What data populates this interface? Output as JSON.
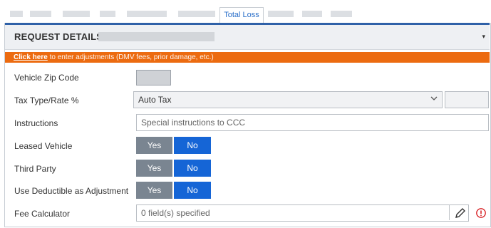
{
  "tabs": {
    "active_label": "Total Loss"
  },
  "header": {
    "title": "REQUEST DETAILS",
    "caret": "▾"
  },
  "banner": {
    "link": "Click here",
    "text": " to enter adjustments (DMV fees, prior damage, etc.)"
  },
  "fields": {
    "zip_label": "Vehicle Zip Code",
    "tax_label": "Tax Type/Rate %",
    "tax_value": "Auto Tax",
    "instructions_label": "Instructions",
    "instructions_placeholder": "Special instructions to CCC",
    "leased_label": "Leased Vehicle",
    "third_party_label": "Third Party",
    "deductible_label": "Use Deductible as Adjustment",
    "fee_label": "Fee Calculator",
    "fee_value": "0 field(s) specified"
  },
  "toggle": {
    "yes": "Yes",
    "no": "No",
    "selected": "No"
  },
  "icons": [
    "chevron-down-icon",
    "pencil-icon",
    "alert-circle-icon"
  ],
  "colors": {
    "accent": "#1565d6",
    "banner": "#ec6b10",
    "header_border": "#2f61a8",
    "alert": "#d9262a"
  }
}
